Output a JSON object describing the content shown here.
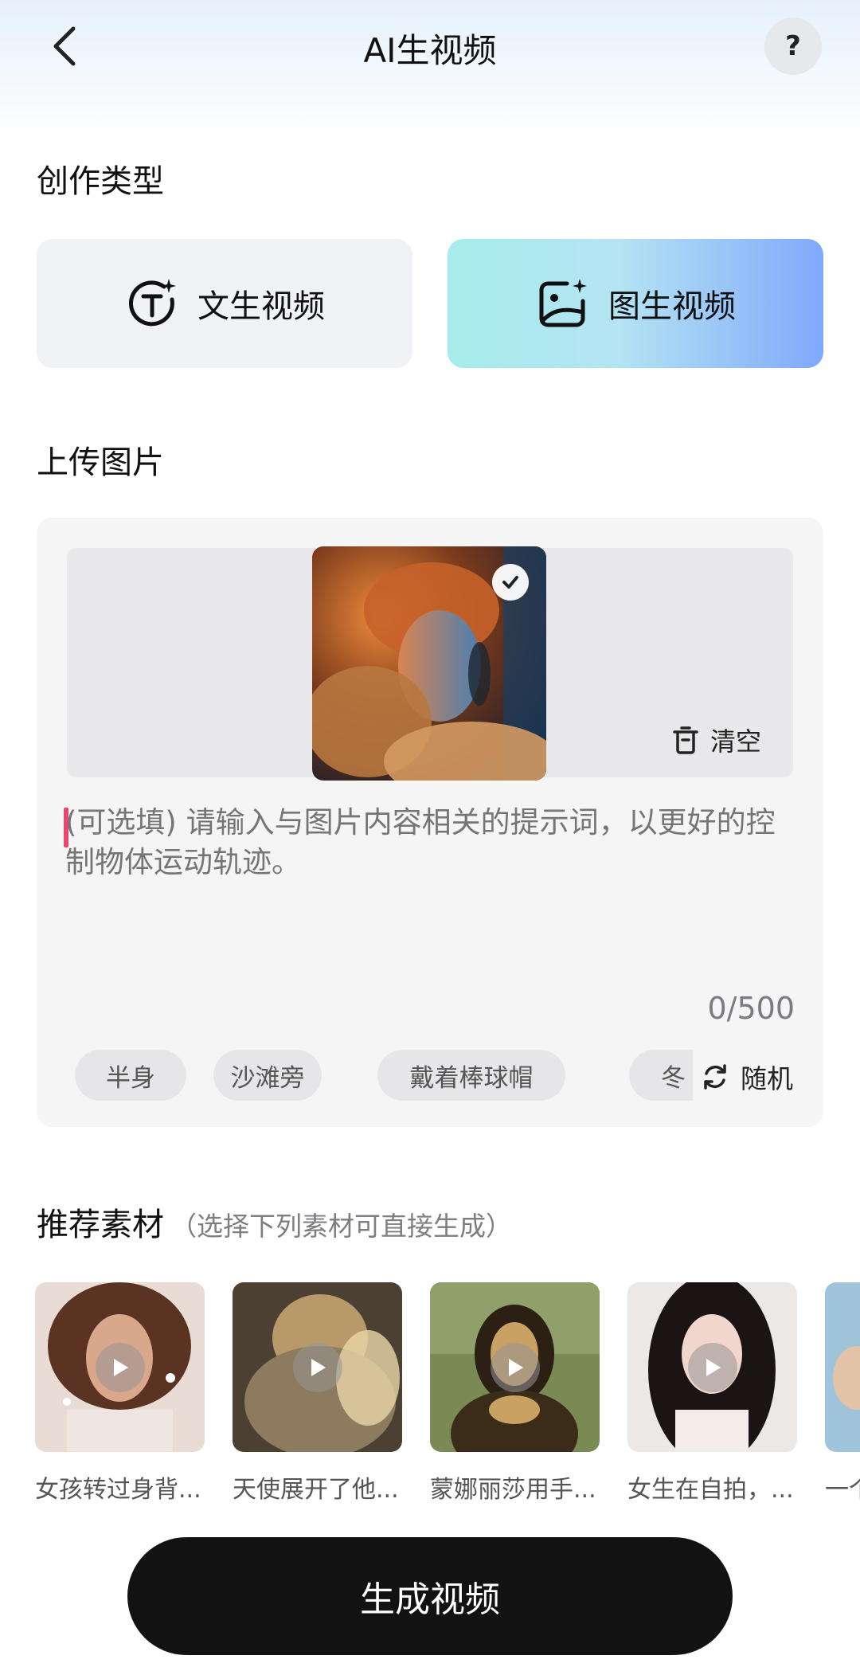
{
  "header": {
    "title": "AI生视频",
    "help_label": "?"
  },
  "create_type": {
    "title": "创作类型",
    "options": [
      {
        "label": "文生视频",
        "icon": "text-sparkle-icon",
        "selected": false
      },
      {
        "label": "图生视频",
        "icon": "image-sparkle-icon",
        "selected": true
      }
    ]
  },
  "upload": {
    "title": "上传图片",
    "clear_label": "清空",
    "prompt_placeholder": "(可选填) 请输入与图片内容相关的提示词，以更好的控制物体运动轨迹。",
    "char_count": "0/500",
    "chips": [
      "半身",
      "沙滩旁",
      "戴着棒球帽",
      "冬"
    ],
    "random_label": "随机"
  },
  "recommend": {
    "title": "推荐素材",
    "subtitle": "（选择下列素材可直接生成）",
    "items": [
      {
        "caption": "女孩转过身背..."
      },
      {
        "caption": "天使展开了他..."
      },
      {
        "caption": "蒙娜丽莎用手..."
      },
      {
        "caption": "女生在自拍，..."
      },
      {
        "caption": "一个"
      }
    ]
  },
  "generate_label": "生成视频",
  "colors": {
    "accent_gradient_start": "#a6ecea",
    "accent_gradient_end": "#7fa9fb",
    "primary_button": "#121212",
    "caret": "#e8456f"
  }
}
